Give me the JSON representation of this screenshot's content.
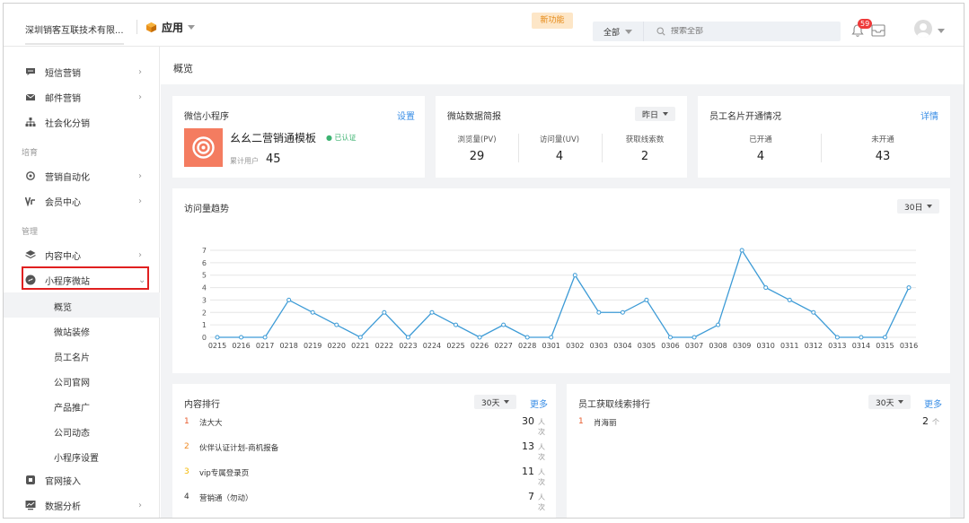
{
  "header": {
    "company": "深圳销客互联技术有限...",
    "app_label": "应用",
    "new_feature": "新功能",
    "search_scope": "全部",
    "search_placeholder": "搜索全部",
    "notification_count": "59"
  },
  "sidebar": {
    "items_top": [
      {
        "label": "短信营销",
        "icon": "chat-icon",
        "arrow": "›"
      },
      {
        "label": "邮件营销",
        "icon": "mail-icon",
        "arrow": "›"
      },
      {
        "label": "社会化分销",
        "icon": "org-tree-icon",
        "arrow": ""
      }
    ],
    "group_nurture": "培育",
    "items_nurture": [
      {
        "label": "营销自动化",
        "icon": "target-icon",
        "arrow": "›"
      },
      {
        "label": "会员中心",
        "icon": "vip-icon",
        "arrow": "›"
      }
    ],
    "group_manage": "管理",
    "items_manage": [
      {
        "label": "内容中心",
        "icon": "layers-icon",
        "arrow": "›"
      },
      {
        "label": "小程序微站",
        "icon": "miniprogram-icon",
        "arrow": "⌄"
      }
    ],
    "sub_items": [
      "概览",
      "微站装修",
      "员工名片",
      "公司官网",
      "产品推广",
      "公司动态",
      "小程序设置"
    ],
    "items_bottom": [
      {
        "label": "官网接入",
        "icon": "website-icon",
        "arrow": ""
      },
      {
        "label": "数据分析",
        "icon": "monitor-icon",
        "arrow": "›"
      }
    ]
  },
  "breadcrumb": "概览",
  "mini_program": {
    "title": "微信小程序",
    "settings_link": "设置",
    "name": "幺幺二营销通模板",
    "certified": "● 已认证",
    "users_label": "累计用户",
    "users_value": "45"
  },
  "site_stats": {
    "title": "微站数据简报",
    "range": "昨日",
    "items": [
      {
        "label": "浏览量(PV)",
        "value": "29"
      },
      {
        "label": "访问量(UV)",
        "value": "4"
      },
      {
        "label": "获取线索数",
        "value": "2"
      }
    ]
  },
  "employee_cards": {
    "title": "员工名片开通情况",
    "detail_link": "详情",
    "items": [
      {
        "label": "已开通",
        "value": "4"
      },
      {
        "label": "未开通",
        "value": "43"
      }
    ]
  },
  "trend": {
    "title": "访问量趋势",
    "range": "30日"
  },
  "chart_data": {
    "type": "line",
    "x": [
      "0215",
      "0216",
      "0217",
      "0218",
      "0219",
      "0220",
      "0221",
      "0222",
      "0223",
      "0224",
      "0225",
      "0226",
      "0227",
      "0228",
      "0301",
      "0302",
      "0303",
      "0304",
      "0305",
      "0306",
      "0307",
      "0308",
      "0309",
      "0310",
      "0311",
      "0312",
      "0313",
      "0314",
      "0315",
      "0316"
    ],
    "values": [
      0,
      0,
      0,
      3,
      2,
      1,
      0,
      2,
      0,
      2,
      1,
      0,
      1,
      0,
      0,
      5,
      2,
      2,
      3,
      0,
      0,
      1,
      7,
      4,
      3,
      2,
      0,
      0,
      0,
      4
    ],
    "yticks": [
      "0",
      "1",
      "2",
      "3",
      "4",
      "5",
      "6",
      "7"
    ],
    "ylim": [
      0,
      7
    ],
    "grid": true,
    "color": "#3d9bd6"
  },
  "content_rank": {
    "title": "内容排行",
    "range": "30天",
    "more": "更多",
    "rows": [
      {
        "num": "1",
        "name": "法大大",
        "value": "30",
        "unit": "人次",
        "color": "#e8582a"
      },
      {
        "num": "2",
        "name": "伙伴认证计划-商机报备",
        "value": "13",
        "unit": "人次",
        "color": "#f08a24"
      },
      {
        "num": "3",
        "name": "vip专属登录页",
        "value": "11",
        "unit": "人次",
        "color": "#f5b800"
      },
      {
        "num": "4",
        "name": "营销通（勿动）",
        "value": "7",
        "unit": "人次",
        "color": "#333333"
      }
    ]
  },
  "lead_rank": {
    "title": "员工获取线索排行",
    "range": "30天",
    "more": "更多",
    "rows": [
      {
        "num": "1",
        "name": "肖海丽",
        "value": "2",
        "unit": "个",
        "color": "#e8582a"
      }
    ]
  }
}
